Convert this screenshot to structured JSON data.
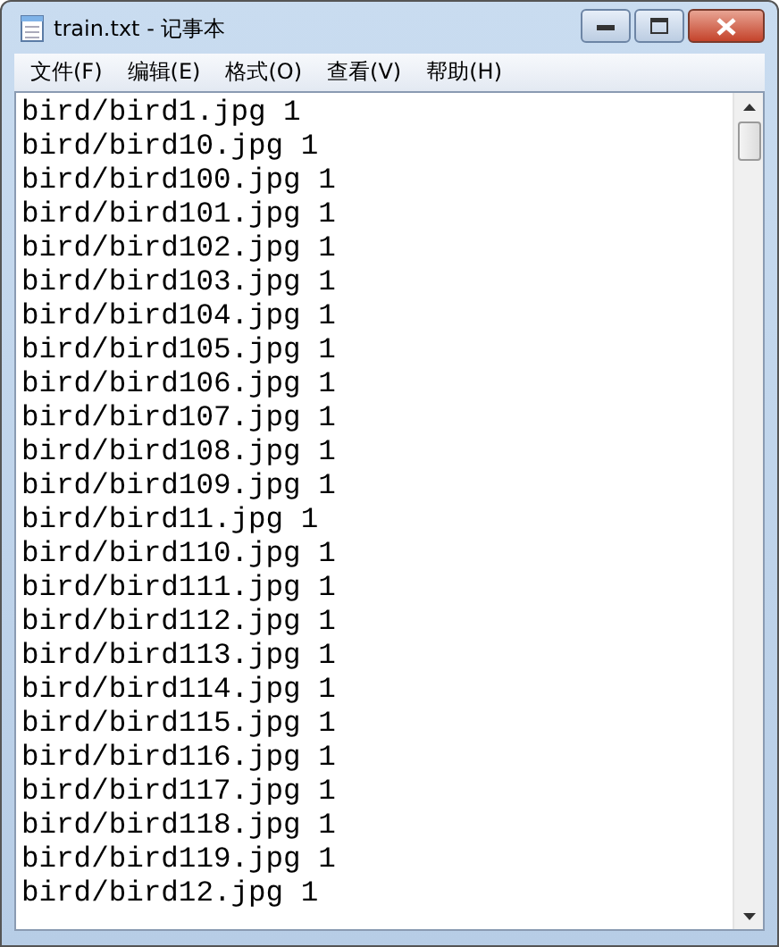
{
  "window": {
    "title": "train.txt - 记事本"
  },
  "menu": [
    "文件(F)",
    "编辑(E)",
    "格式(O)",
    "查看(V)",
    "帮助(H)"
  ],
  "lines": [
    "bird/bird1.jpg 1",
    "bird/bird10.jpg 1",
    "bird/bird100.jpg 1",
    "bird/bird101.jpg 1",
    "bird/bird102.jpg 1",
    "bird/bird103.jpg 1",
    "bird/bird104.jpg 1",
    "bird/bird105.jpg 1",
    "bird/bird106.jpg 1",
    "bird/bird107.jpg 1",
    "bird/bird108.jpg 1",
    "bird/bird109.jpg 1",
    "bird/bird11.jpg 1",
    "bird/bird110.jpg 1",
    "bird/bird111.jpg 1",
    "bird/bird112.jpg 1",
    "bird/bird113.jpg 1",
    "bird/bird114.jpg 1",
    "bird/bird115.jpg 1",
    "bird/bird116.jpg 1",
    "bird/bird117.jpg 1",
    "bird/bird118.jpg 1",
    "bird/bird119.jpg 1",
    "bird/bird12.jpg 1"
  ]
}
